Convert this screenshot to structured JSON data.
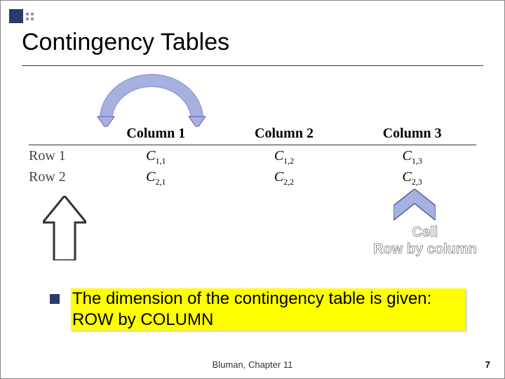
{
  "title": "Contingency Tables",
  "table": {
    "columns": [
      "Column 1",
      "Column 2",
      "Column 3"
    ],
    "rows": [
      "Row 1",
      "Row 2"
    ],
    "cells": [
      [
        "C",
        "1,1",
        "C",
        "1,2",
        "C",
        "1,3"
      ],
      [
        "C",
        "2,1",
        "C",
        "2,2",
        "C",
        "2,3"
      ]
    ]
  },
  "cell_label": {
    "l1": "Cell",
    "l2": "Row by column"
  },
  "bullet": "The dimension of the contingency table is given:  ROW by COLUMN",
  "footer_center": "Bluman, Chapter 11",
  "footer_right": "7",
  "colors": {
    "arrow_fill": "#a7b1e0",
    "arrow_stroke": "#5a5fa0"
  }
}
